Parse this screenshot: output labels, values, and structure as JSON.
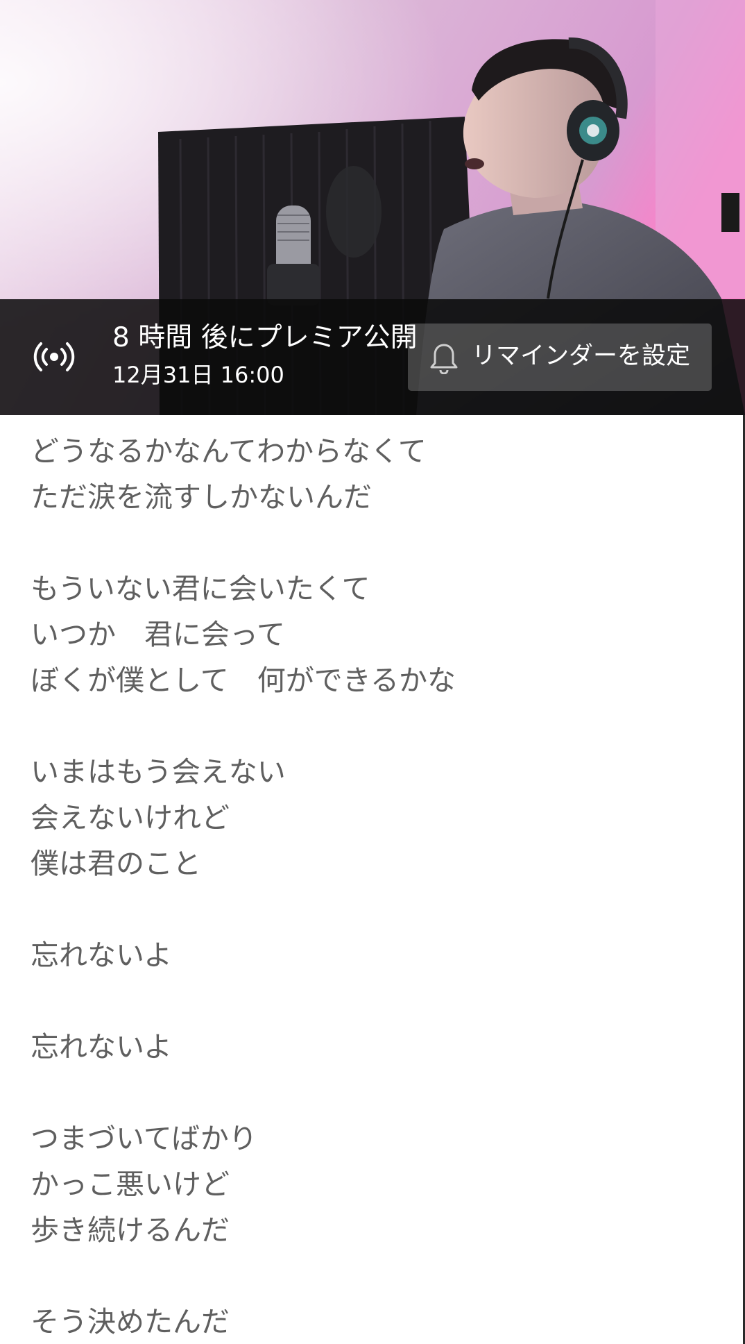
{
  "premiere": {
    "title": "8 時間 後にプレミア公開",
    "date": "12月31日 16:00",
    "reminder_label": "リマインダーを設定",
    "live_icon": "live-broadcast-icon",
    "bell_icon": "bell-icon"
  },
  "lyrics": {
    "stanza1": {
      "line1": "どうなるかなんてわからなくて",
      "line2": "ただ涙を流すしかないんだ"
    },
    "stanza2": {
      "line1": "もういない君に会いたくて",
      "line2": "いつか　君に会って",
      "line3": "ぼくが僕として　何ができるかな"
    },
    "stanza3": {
      "line1": "いまはもう会えない",
      "line2": "会えないけれど",
      "line3": "僕は君のこと"
    },
    "stanza4": {
      "line1": "忘れないよ"
    },
    "stanza5": {
      "line1": "忘れないよ"
    },
    "stanza6": {
      "line1": "つまづいてばかり",
      "line2": "かっこ悪いけど",
      "line3": "歩き続けるんだ"
    },
    "stanza7": {
      "line1": "そう決めたんだ"
    }
  },
  "colors": {
    "overlay": "#0a0a0a",
    "lyric_text": "#5f5f5f",
    "background": "#ffffff"
  }
}
